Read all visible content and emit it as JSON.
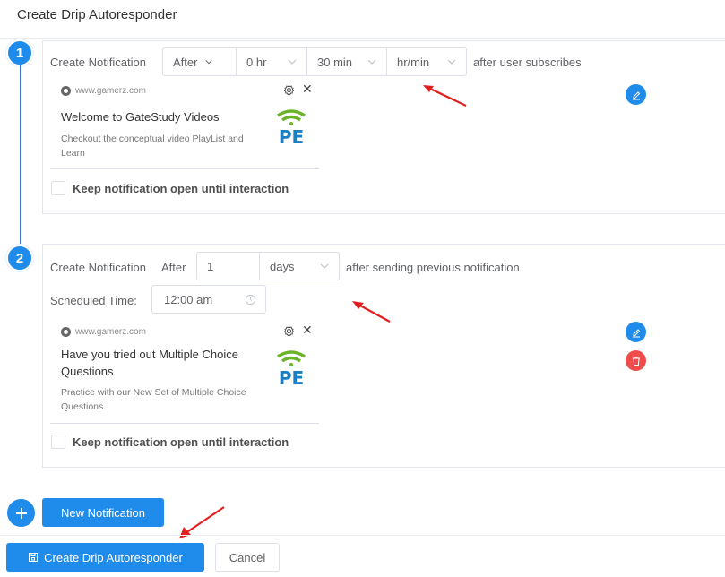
{
  "dialog": {
    "title": "Create Drip Autoresponder"
  },
  "steps": [
    {
      "number": "1",
      "create_label": "Create Notification",
      "timing": {
        "mode": "After",
        "hours": "0 hr",
        "minutes": "30 min",
        "unit_placeholder": "hr/min"
      },
      "suffix": "after user subscribes",
      "preview": {
        "site": "www.gamerz.com",
        "title": "Welcome to GateStudy Videos",
        "body": "Checkout the conceptual video PlayList and Learn",
        "logo_text": "PE"
      },
      "keep_open_label": "Keep notification open until interaction",
      "keep_open_checked": false
    },
    {
      "number": "2",
      "create_label": "Create Notification",
      "after_label": "After",
      "timing": {
        "value": "1",
        "unit": "days"
      },
      "suffix": "after sending previous notification",
      "scheduled_label": "Scheduled Time:",
      "scheduled_time": "12:00 am",
      "preview": {
        "site": "www.gamerz.com",
        "title": "Have you tried out Multiple Choice Questions",
        "body": "Practice with our New Set of Multiple Choice Questions",
        "logo_text": "PE"
      },
      "keep_open_label": "Keep notification open until interaction",
      "keep_open_checked": false
    }
  ],
  "actions": {
    "new_notification": "New Notification",
    "create": "Create Drip Autoresponder",
    "cancel": "Cancel"
  },
  "colors": {
    "primary": "#1f8ceb",
    "danger": "#f04c4c",
    "annotation_arrow": "#e02020",
    "logo_green": "#6bb42a",
    "logo_blue": "#1b7fc4"
  }
}
